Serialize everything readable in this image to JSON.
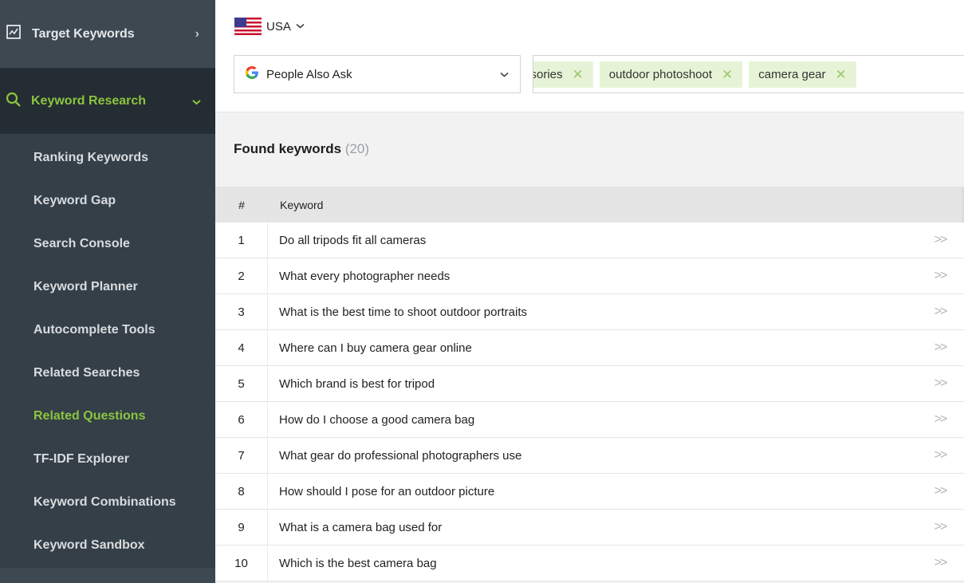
{
  "sidebar": {
    "top_item": {
      "label": "Target Keywords",
      "icon": "chart-line-icon"
    },
    "active_section": {
      "label": "Keyword Research",
      "icon": "search-icon"
    },
    "sub_items": [
      {
        "label": "Ranking Keywords"
      },
      {
        "label": "Keyword Gap"
      },
      {
        "label": "Search Console"
      },
      {
        "label": "Keyword Planner"
      },
      {
        "label": "Autocomplete Tools"
      },
      {
        "label": "Related Searches"
      },
      {
        "label": "Related Questions",
        "active": true
      },
      {
        "label": "TF-IDF Explorer"
      },
      {
        "label": "Keyword Combinations"
      },
      {
        "label": "Keyword Sandbox"
      }
    ]
  },
  "country": {
    "label": "USA",
    "icon": "usa-flag-icon"
  },
  "engine": {
    "label": "People Also Ask",
    "icon": "google-g-icon"
  },
  "tags": [
    {
      "label": "ssories"
    },
    {
      "label": "outdoor photoshoot"
    },
    {
      "label": "camera gear"
    }
  ],
  "results": {
    "title": "Found keywords",
    "count": "(20)",
    "columns": {
      "num": "#",
      "keyword": "Keyword"
    },
    "rows": [
      {
        "num": "1",
        "keyword": "Do all tripods fit all cameras"
      },
      {
        "num": "2",
        "keyword": "What every photographer needs"
      },
      {
        "num": "3",
        "keyword": "What is the best time to shoot outdoor portraits"
      },
      {
        "num": "4",
        "keyword": "Where can I buy camera gear online"
      },
      {
        "num": "5",
        "keyword": "Which brand is best for tripod"
      },
      {
        "num": "6",
        "keyword": "How do I choose a good camera bag"
      },
      {
        "num": "7",
        "keyword": "What gear do professional photographers use"
      },
      {
        "num": "8",
        "keyword": "How should I pose for an outdoor picture"
      },
      {
        "num": "9",
        "keyword": "What is a camera bag used for"
      },
      {
        "num": "10",
        "keyword": "Which is the best camera bag"
      }
    ]
  },
  "colors": {
    "accent": "#8cc43f",
    "sidebar_bg": "#343f48",
    "tag_bg": "#e7f3d7"
  }
}
